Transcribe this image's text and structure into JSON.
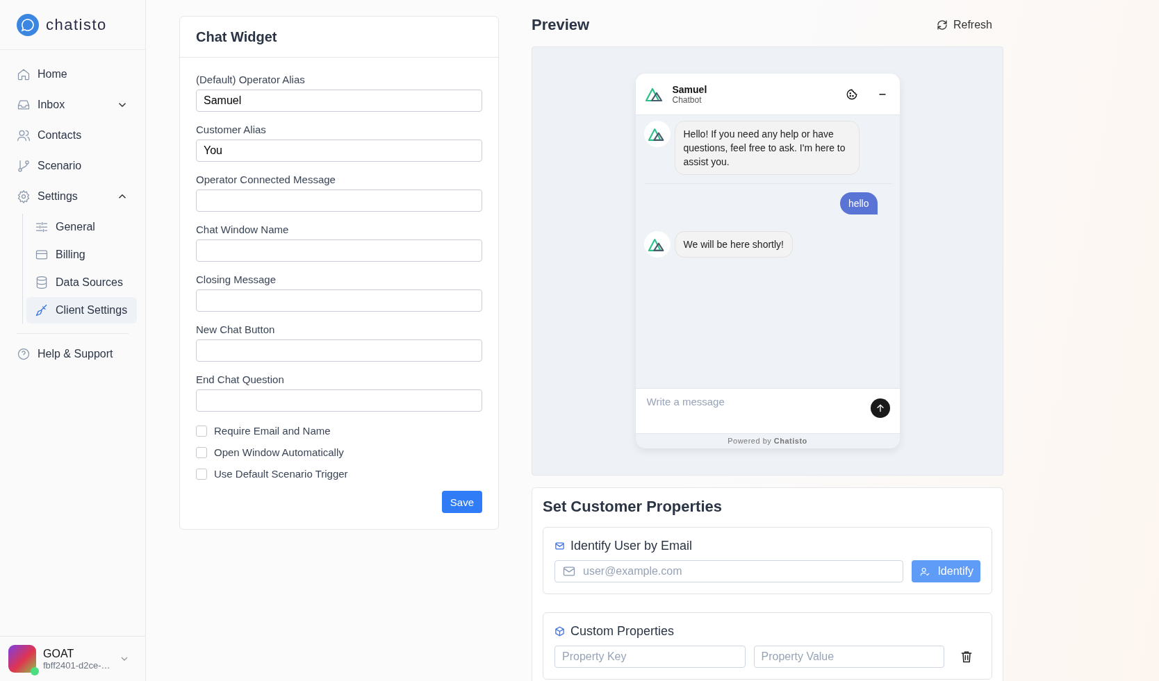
{
  "sidebar": {
    "brand": "chatisto",
    "nav": [
      {
        "label": "Home",
        "kind": "item",
        "selected": false
      },
      {
        "label": "Inbox",
        "kind": "group",
        "expanded": false,
        "selected": false
      },
      {
        "label": "Contacts",
        "kind": "item",
        "selected": false
      },
      {
        "label": "Scenario",
        "kind": "item",
        "selected": false
      },
      {
        "label": "Settings",
        "kind": "group",
        "expanded": true,
        "selected": false,
        "children": [
          {
            "label": "General",
            "selected": false
          },
          {
            "label": "Billing",
            "selected": false
          },
          {
            "label": "Data Sources",
            "selected": false
          },
          {
            "label": "Client Settings",
            "selected": true
          }
        ]
      }
    ],
    "help": "Help & Support",
    "user": {
      "name": "GOAT",
      "id": "fbff2401-d2ce-…",
      "online": true
    }
  },
  "chat_widget": {
    "title": "Chat Widget",
    "fields": [
      {
        "label": "(Default) Operator Alias",
        "value": "Samuel"
      },
      {
        "label": "Customer Alias",
        "value": "You"
      },
      {
        "label": "Operator Connected Message"
      },
      {
        "label": "Chat Window Name"
      },
      {
        "label": "Closing Message"
      },
      {
        "label": "New Chat Button"
      },
      {
        "label": "End Chat Question"
      }
    ],
    "checkboxes": [
      {
        "label": "Require Email and Name",
        "checked": false
      },
      {
        "label": "Open Window Automatically",
        "checked": false
      },
      {
        "label": "Use Default Scenario Trigger",
        "checked": false
      }
    ],
    "save": "Save"
  },
  "preview": {
    "title": "Preview",
    "refresh": "Refresh",
    "widget": {
      "name": "Samuel",
      "subtitle": "Chatbot",
      "messages": [
        {
          "kind": "bot",
          "text": "Hello! If you need any help or have questions, feel free to ask. I'm here to assist you."
        },
        {
          "kind": "user",
          "text": "hello"
        },
        {
          "kind": "bot",
          "text": "We will be here shortly!"
        }
      ],
      "placeholder": "Write a message",
      "powered_by": "Powered by **Chatisto**"
    }
  },
  "customer_properties": {
    "title": "Set Customer Properties",
    "identify": {
      "title": "Identify User by Email",
      "placeholder": "user@example.com",
      "button": "Identify"
    },
    "custom": {
      "title": "Custom Properties",
      "key_placeholder": "Property Key",
      "value_placeholder": "Property Value"
    }
  }
}
